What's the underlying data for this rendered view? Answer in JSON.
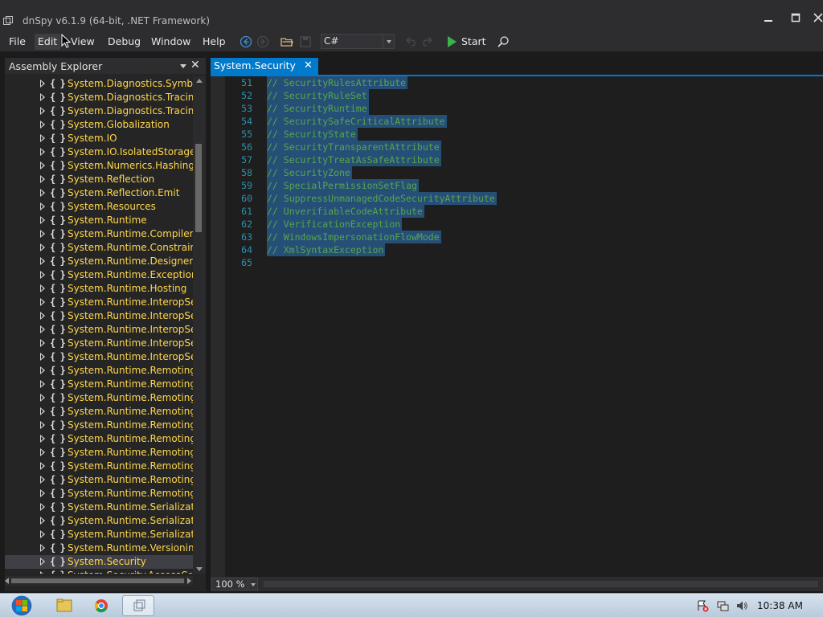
{
  "window": {
    "title": "dnSpy v6.1.9 (64-bit, .NET Framework)"
  },
  "menu": {
    "items": [
      "File",
      "Edit",
      "View",
      "Debug",
      "Window",
      "Help"
    ]
  },
  "toolbar": {
    "language": "C#",
    "start_label": "Start"
  },
  "explorer": {
    "title": "Assembly Explorer",
    "items": [
      "System.Diagnostics.SymbolSt",
      "System.Diagnostics.Tracing",
      "System.Diagnostics.Tracing.In",
      "System.Globalization",
      "System.IO",
      "System.IO.IsolatedStorage",
      "System.Numerics.Hashing",
      "System.Reflection",
      "System.Reflection.Emit",
      "System.Resources",
      "System.Runtime",
      "System.Runtime.CompilerSer",
      "System.Runtime.Constrained",
      "System.Runtime.DesignerServ",
      "System.Runtime.ExceptionSer",
      "System.Runtime.Hosting",
      "System.Runtime.InteropServi",
      "System.Runtime.InteropServi",
      "System.Runtime.InteropServi",
      "System.Runtime.InteropServi",
      "System.Runtime.InteropServi",
      "System.Runtime.Remoting",
      "System.Runtime.Remoting.A",
      "System.Runtime.Remoting.Cl",
      "System.Runtime.Remoting.C",
      "System.Runtime.Remoting.Li",
      "System.Runtime.Remoting.M",
      "System.Runtime.Remoting.M",
      "System.Runtime.Remoting.M",
      "System.Runtime.Remoting.Pr",
      "System.Runtime.Remoting.Se",
      "System.Runtime.Serialization",
      "System.Runtime.Serialization.",
      "System.Runtime.Serialization.",
      "System.Runtime.Versioning",
      "System.Security",
      "System.Security.AccessContr"
    ],
    "selected_index": 35
  },
  "editor": {
    "tab_label": "System.Security",
    "lines": [
      {
        "num": "51",
        "text": "// SecurityRulesAttribute"
      },
      {
        "num": "52",
        "text": "// SecurityRuleSet"
      },
      {
        "num": "53",
        "text": "// SecurityRuntime"
      },
      {
        "num": "54",
        "text": "// SecuritySafeCriticalAttribute"
      },
      {
        "num": "55",
        "text": "// SecurityState"
      },
      {
        "num": "56",
        "text": "// SecurityTransparentAttribute"
      },
      {
        "num": "57",
        "text": "// SecurityTreatAsSafeAttribute"
      },
      {
        "num": "58",
        "text": "// SecurityZone"
      },
      {
        "num": "59",
        "text": "// SpecialPermissionSetFlag"
      },
      {
        "num": "60",
        "text": "// SuppressUnmanagedCodeSecurityAttribute"
      },
      {
        "num": "61",
        "text": "// UnverifiableCodeAttribute"
      },
      {
        "num": "62",
        "text": "// VerificationException"
      },
      {
        "num": "63",
        "text": "// WindowsImpersonationFlowMode"
      },
      {
        "num": "64",
        "text": "// XmlSyntaxException"
      },
      {
        "num": "65",
        "text": ""
      }
    ],
    "zoom": "100 %"
  },
  "taskbar": {
    "clock": "10:38 AM"
  },
  "colors": {
    "accent": "#007acc",
    "namespace": "#ffd74a",
    "comment": "#57a64a",
    "selection": "#264f78",
    "line_number": "#2b91af"
  }
}
